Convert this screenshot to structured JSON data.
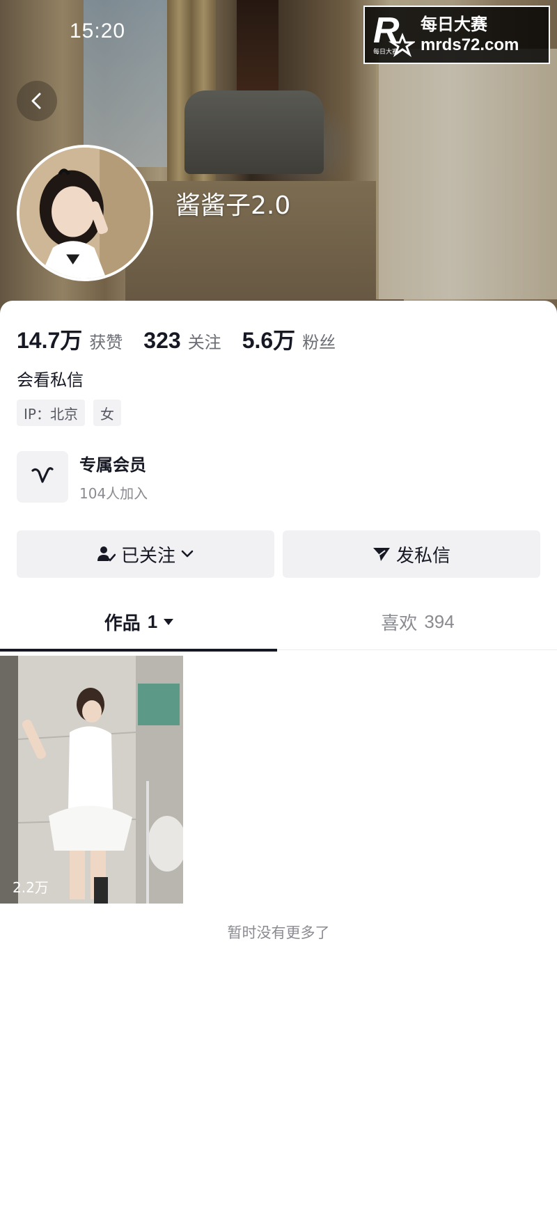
{
  "status_bar": {
    "time": "15:20"
  },
  "watermark": {
    "title": "每日大赛",
    "url": "mrds72.com",
    "logo_letter": "R",
    "logo_sub": "每日大赛"
  },
  "profile": {
    "nickname": "酱酱子2.0",
    "bio": "会看私信",
    "tags": [
      "IP：北京",
      "女"
    ],
    "stats": [
      {
        "value": "14.7万",
        "label": "获赞"
      },
      {
        "value": "323",
        "label": "关注"
      },
      {
        "value": "5.6万",
        "label": "粉丝"
      }
    ]
  },
  "membership": {
    "title": "专属会员",
    "subtitle": "104人加入"
  },
  "actions": {
    "follow_label": "已关注",
    "message_label": "发私信"
  },
  "tabs": {
    "works_label": "作品",
    "works_count": "1",
    "likes_label": "喜欢",
    "likes_count": "394"
  },
  "videos": [
    {
      "likes": "2.2万"
    }
  ],
  "footer": {
    "no_more": "暂时没有更多了"
  },
  "colors": {
    "primary_text": "#161823",
    "secondary_text": "#8a8b91",
    "button_bg": "#f1f1f3"
  },
  "icons": [
    "back-icon",
    "follow-check-icon",
    "chevron-down-icon",
    "send-icon",
    "member-v-icon",
    "caret-down-icon",
    "heart-icon"
  ]
}
